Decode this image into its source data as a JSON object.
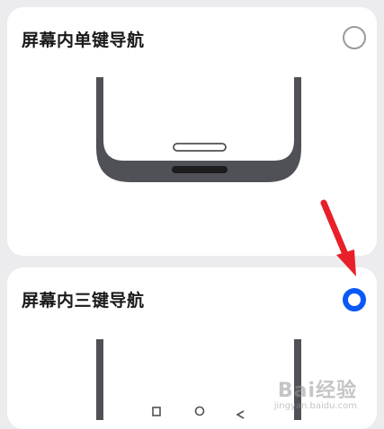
{
  "options": [
    {
      "label": "屏幕内单键导航",
      "selected": false
    },
    {
      "label": "屏幕内三键导航",
      "selected": true
    }
  ],
  "watermark": {
    "text": "Bai经验",
    "subtext": "jingyan.baidu.com"
  },
  "colors": {
    "background": "#ececee",
    "card": "#ffffff",
    "accent": "#0a59f7",
    "phone_frame": "#4f5156",
    "annotation_arrow": "#e8202a"
  },
  "icons": {
    "radio_unselected": "radio-off-icon",
    "radio_selected": "radio-on-icon",
    "annotation": "red-arrow-icon",
    "nav_square": "square-nav-icon",
    "nav_circle": "circle-nav-icon",
    "nav_triangle": "back-triangle-icon"
  }
}
